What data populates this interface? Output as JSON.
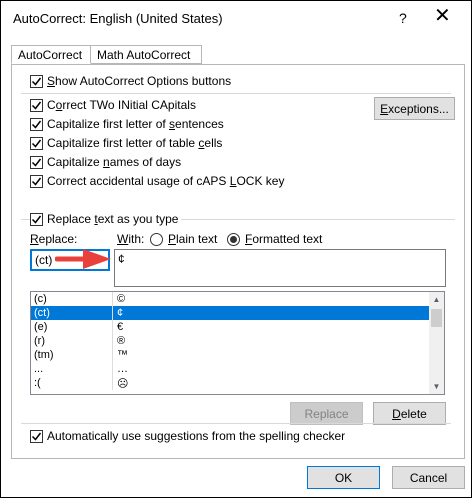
{
  "window": {
    "title": "AutoCorrect: English (United States)",
    "help_label": "?",
    "close_glyph": "✕"
  },
  "tabs": [
    {
      "label": "AutoCorrect",
      "active": true
    },
    {
      "label": "Math AutoCorrect",
      "active": false
    }
  ],
  "options": {
    "show_buttons": {
      "pre": "",
      "u": "S",
      "post": "how AutoCorrect Options buttons",
      "checked": true
    },
    "two_initials": {
      "pre": "C",
      "u": "o",
      "post": "rrect TWo INitial CApitals",
      "checked": true
    },
    "sentences": {
      "pre": "Capitalize first letter of ",
      "u": "s",
      "post": "entences",
      "checked": true
    },
    "table_cells": {
      "pre": "Capitalize first letter of table ",
      "u": "c",
      "post": "ells",
      "checked": true
    },
    "names_days": {
      "pre": "Capitalize ",
      "u": "n",
      "post": "ames of days",
      "checked": true
    },
    "caps_lock": {
      "pre": "Correct accidental usage of cAPS ",
      "u": "L",
      "post": "OCK key",
      "checked": true
    }
  },
  "exceptions_button": {
    "pre": "",
    "u": "E",
    "post": "xceptions..."
  },
  "replace_as_type": {
    "pre": "Replace ",
    "u": "t",
    "post": "ext as you type",
    "checked": true
  },
  "replace_label": {
    "pre": "",
    "u": "R",
    "post": "eplace:"
  },
  "with_label": {
    "pre": "",
    "u": "W",
    "post": "ith:"
  },
  "plain_text": {
    "pre": "",
    "u": "P",
    "post": "lain text",
    "selected": false
  },
  "formatted_text": {
    "pre": "",
    "u": "F",
    "post": "ormatted text",
    "selected": true
  },
  "replace_value": "(ct)",
  "with_value": "¢",
  "entries": [
    {
      "replace": "(c)",
      "with": "©",
      "selected": false
    },
    {
      "replace": "(ct)",
      "with": "¢",
      "selected": true
    },
    {
      "replace": "(e)",
      "with": "€",
      "selected": false
    },
    {
      "replace": "(r)",
      "with": "®",
      "selected": false
    },
    {
      "replace": "(tm)",
      "with": "™",
      "selected": false
    },
    {
      "replace": "...",
      "with": "…",
      "selected": false
    },
    {
      "replace": ":(",
      "with": "☹",
      "selected": false
    }
  ],
  "replace_button": "Replace",
  "delete_button": {
    "pre": "",
    "u": "D",
    "post": "elete"
  },
  "spelling_suggestions": {
    "pre": "Automatically use suggestions from the spelling checker",
    "u": "",
    "post": "",
    "checked": true
  },
  "ok_button": "OK",
  "cancel_button": "Cancel",
  "colors": {
    "selection": "#0078d7",
    "annotation_arrow": "#e8403a"
  }
}
